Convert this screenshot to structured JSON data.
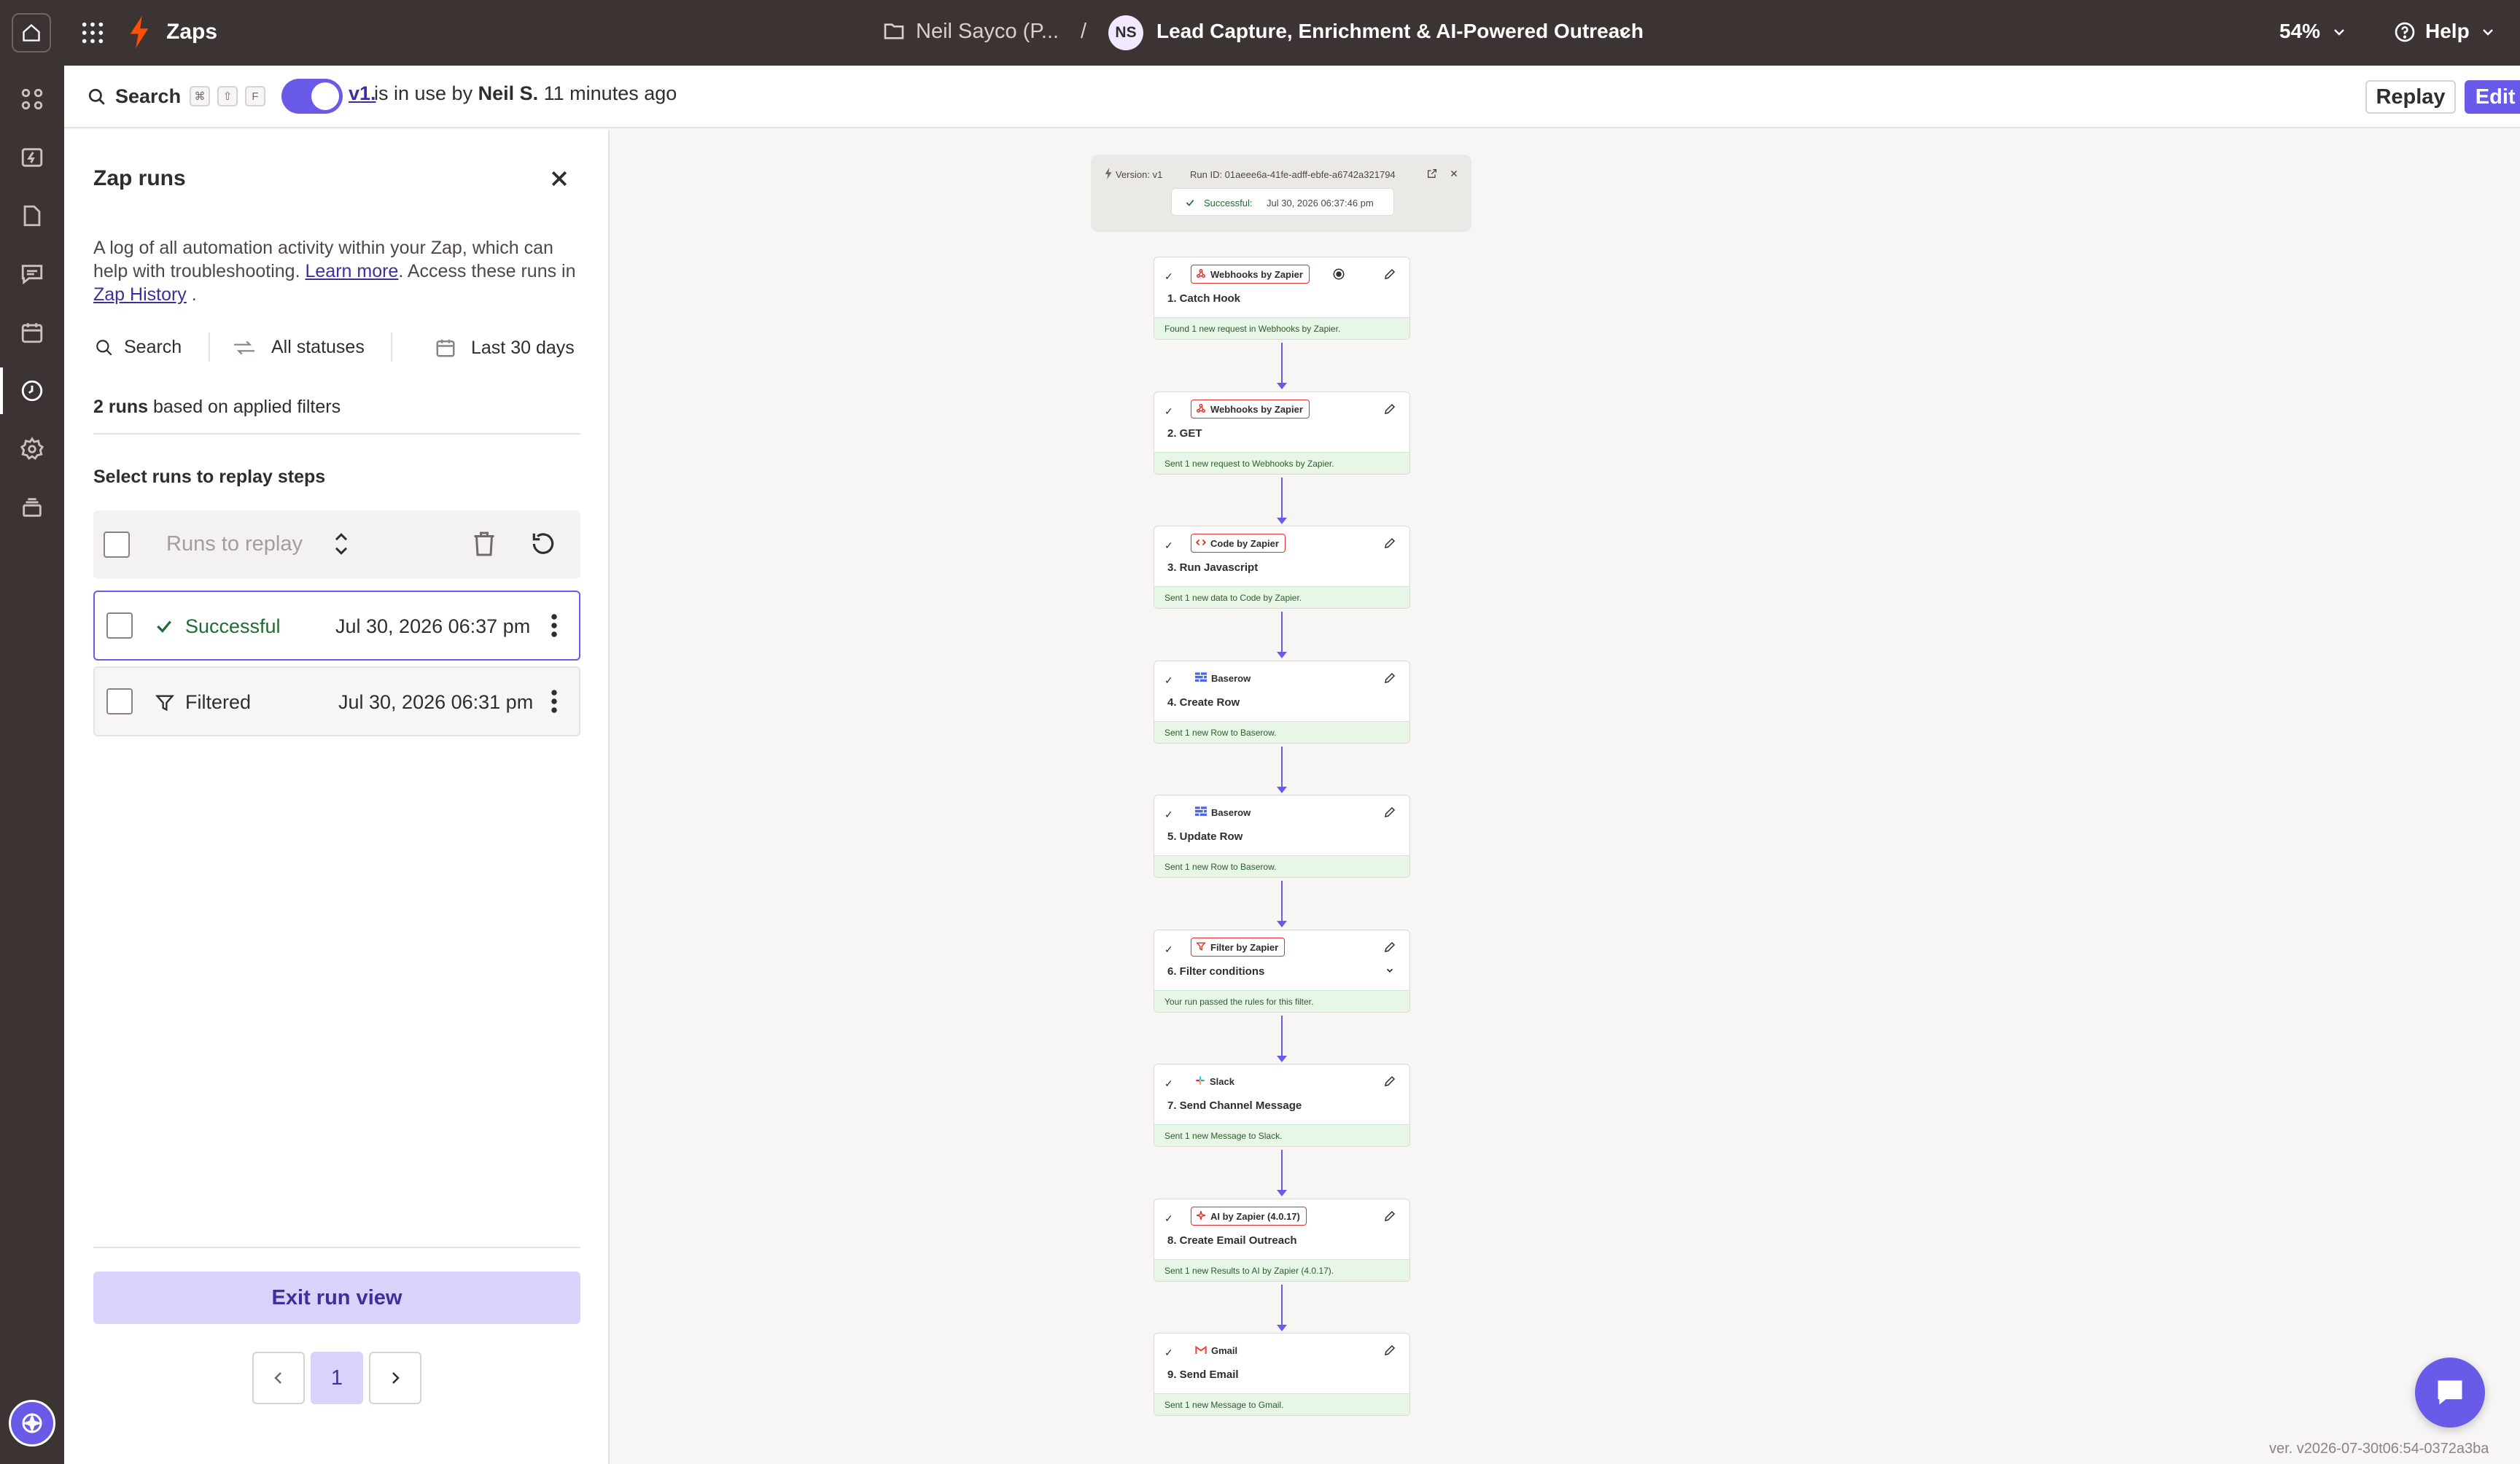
{
  "topbar": {
    "app_label": "Zaps",
    "folder_crumb": "Neil Sayco (P...",
    "crumb_separator": "/",
    "owner_initials": "NS",
    "zap_name": "Lead Capture, Enrichment & AI-Powered Outreach",
    "zoom": "54%",
    "help_label": "Help"
  },
  "subbar": {
    "search_label": "Search",
    "shortcut_keys": [
      "⌘",
      "⇧",
      "F"
    ],
    "toggle_on": true,
    "version_link": "v1.",
    "in_use_text": "is in use by",
    "user_name": "Neil S.",
    "time_ago": "11 minutes ago",
    "replay_label": "Replay",
    "edit_label": "Edit Zap"
  },
  "panel": {
    "title": "Zap runs",
    "description_1": "A log of all automation activity within your Zap, which can help with troubleshooting.",
    "learn_more": "Learn more",
    "description_2": ". Access these runs in",
    "zap_history": "Zap History",
    "description_3": ".",
    "filter_search": "Search",
    "filter_status": "All statuses",
    "filter_date": "Last 30 days",
    "count_bold": "2 runs",
    "count_rest": "based on applied filters",
    "replay_heading": "Select runs to replay steps",
    "runs_to_replay": "Runs to replay",
    "runs": [
      {
        "status": "Successful",
        "date": "Jul 30, 2026 06:37 pm",
        "selected": true
      },
      {
        "status": "Filtered",
        "date": "Jul 30, 2026 06:31 pm",
        "selected": false
      }
    ],
    "exit_label": "Exit run view",
    "current_page": "1"
  },
  "canvas": {
    "run_info": {
      "version": "Version: v1",
      "run_id": "Run ID: 01aeee6a-41fe-adff-ebfe-a6742a321794",
      "status": "Successful:",
      "timestamp": "Jul 30, 2026 06:37:46 pm"
    },
    "steps": [
      {
        "app": "Webhooks by Zapier",
        "name": "1. Catch Hook",
        "result": "Found 1 new request in Webhooks by Zapier.",
        "icon": "webhook-icon"
      },
      {
        "app": "Webhooks by Zapier",
        "name": "2. GET",
        "result": "Sent 1 new request to Webhooks by Zapier.",
        "icon": "webhook-icon"
      },
      {
        "app": "Code by Zapier",
        "name": "3. Run Javascript",
        "result": "Sent 1 new data to Code by Zapier.",
        "icon": "code-icon"
      },
      {
        "app": "Baserow",
        "name": "4. Create Row",
        "result": "Sent 1 new Row to Baserow.",
        "icon": "baserow-icon"
      },
      {
        "app": "Baserow",
        "name": "5. Update Row",
        "result": "Sent 1 new Row to Baserow.",
        "icon": "baserow-icon"
      },
      {
        "app": "Filter by Zapier",
        "name": "6. Filter conditions",
        "result": "Your run passed the rules for this filter.",
        "icon": "filter-icon"
      },
      {
        "app": "Slack",
        "name": "7. Send Channel Message",
        "result": "Sent 1 new Message to Slack.",
        "icon": "slack-icon"
      },
      {
        "app": "AI by Zapier (4.0.17)",
        "name": "8. Create Email Outreach",
        "result": "Sent 1 new Results to AI by Zapier (4.0.17).",
        "icon": "ai-icon"
      },
      {
        "app": "Gmail",
        "name": "9. Send Email",
        "result": "Sent 1 new Message to Gmail.",
        "icon": "gmail-icon"
      }
    ],
    "build_version": "ver. v2026-07-30t06:54-0372a3ba"
  },
  "colors": {
    "accent": "#695be8",
    "topbar": "#3b3432",
    "success_bg": "#e8f6e8",
    "zapier_orange": "#ff4f00"
  }
}
